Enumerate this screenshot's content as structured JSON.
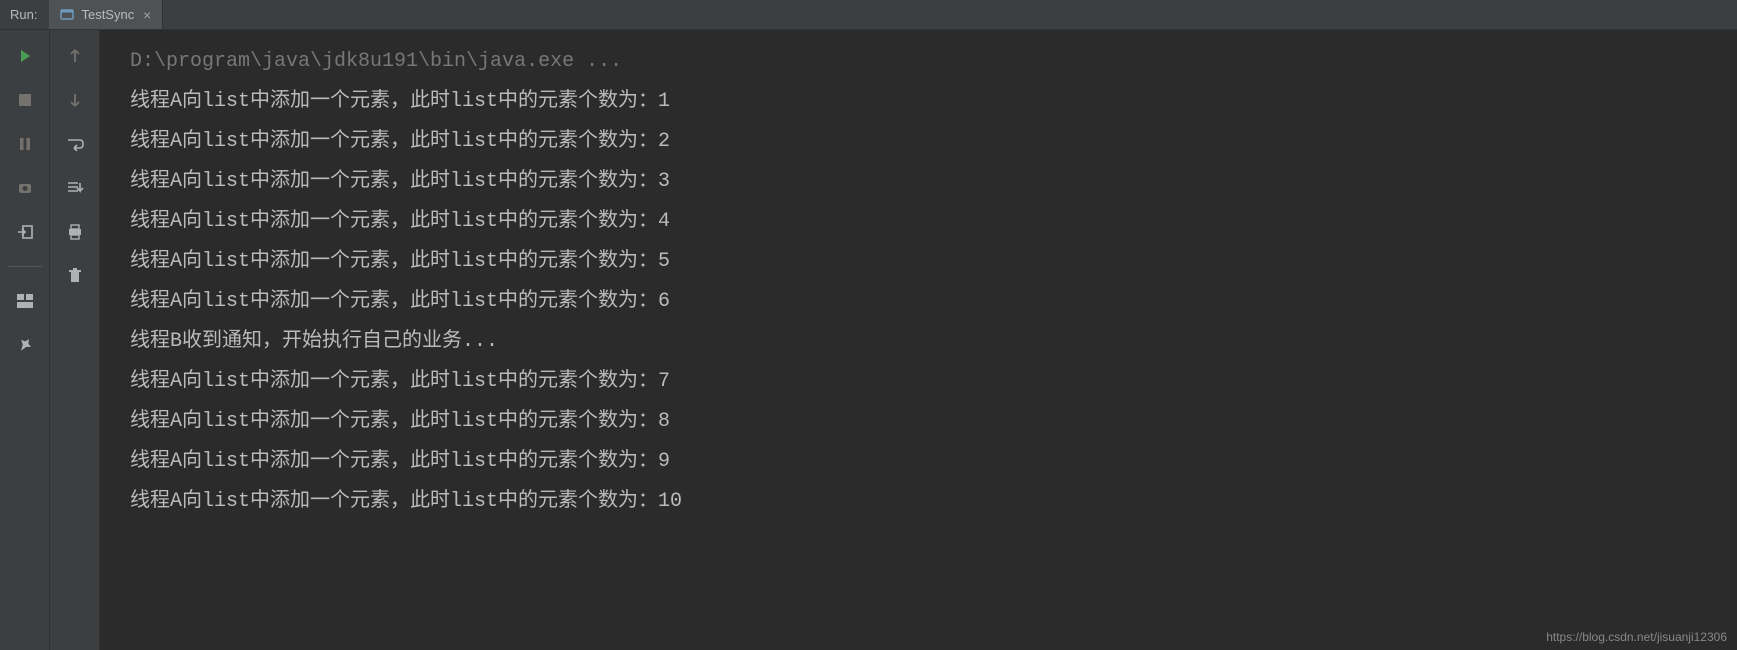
{
  "header": {
    "run_label": "Run:",
    "tab": {
      "label": "TestSync",
      "close": "×"
    }
  },
  "console": {
    "lines": [
      {
        "text": "D:\\program\\java\\jdk8u191\\bin\\java.exe ...",
        "cmd": true
      },
      {
        "text": "线程A向list中添加一个元素，此时list中的元素个数为：1"
      },
      {
        "text": "线程A向list中添加一个元素，此时list中的元素个数为：2"
      },
      {
        "text": "线程A向list中添加一个元素，此时list中的元素个数为：3"
      },
      {
        "text": "线程A向list中添加一个元素，此时list中的元素个数为：4"
      },
      {
        "text": "线程A向list中添加一个元素，此时list中的元素个数为：5"
      },
      {
        "text": "线程A向list中添加一个元素，此时list中的元素个数为：6"
      },
      {
        "text": "线程B收到通知，开始执行自己的业务..."
      },
      {
        "text": "线程A向list中添加一个元素，此时list中的元素个数为：7"
      },
      {
        "text": "线程A向list中添加一个元素，此时list中的元素个数为：8"
      },
      {
        "text": "线程A向list中添加一个元素，此时list中的元素个数为：9"
      },
      {
        "text": "线程A向list中添加一个元素，此时list中的元素个数为：10"
      }
    ]
  },
  "watermark": "https://blog.csdn.net/jisuanji12306"
}
